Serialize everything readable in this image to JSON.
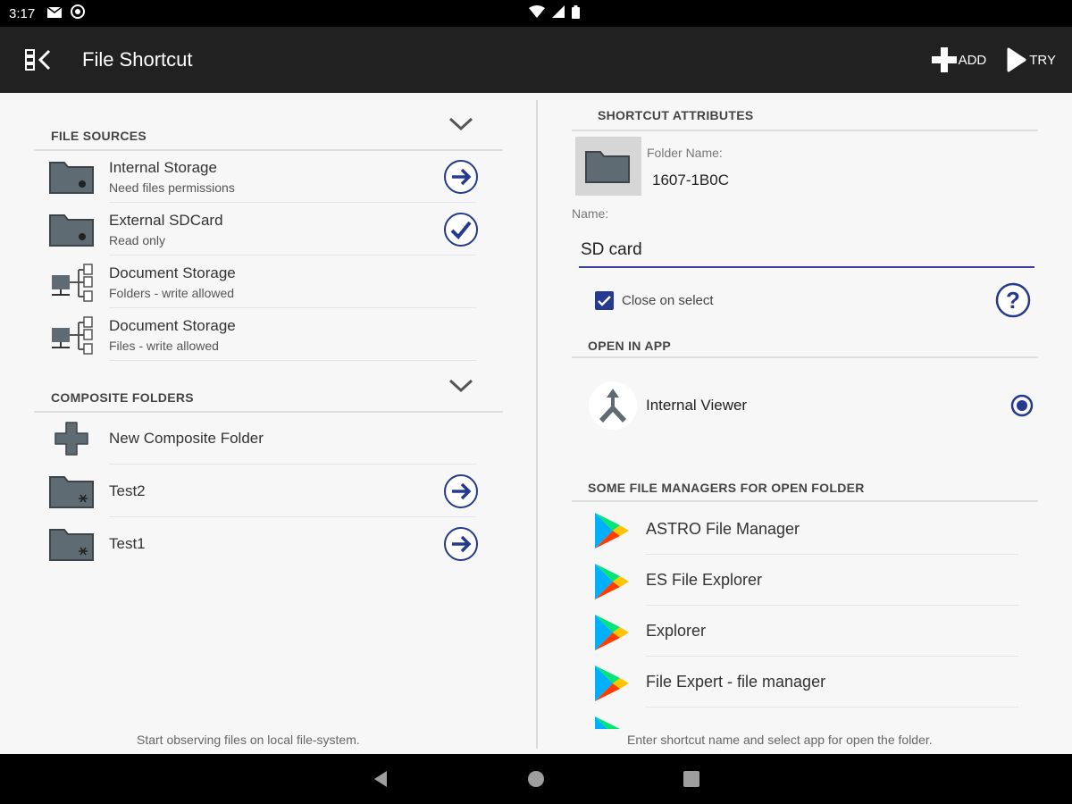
{
  "status": {
    "time": "3:17"
  },
  "toolbar": {
    "title": "File Shortcut",
    "add_label": "ADD",
    "try_label": "TRY"
  },
  "left": {
    "file_sources_heading": "FILE SOURCES",
    "file_sources": [
      {
        "title": "Internal Storage",
        "subtitle": "Need files permissions",
        "icon": "folder-icon",
        "action": "arrow-right-circle-icon"
      },
      {
        "title": "External SDCard",
        "subtitle": "Read only",
        "icon": "folder-icon",
        "action": "check-circle-icon"
      },
      {
        "title": "Document Storage",
        "subtitle": "Folders - write allowed",
        "icon": "document-tree-icon",
        "action": ""
      },
      {
        "title": "Document Storage",
        "subtitle": "Files - write allowed",
        "icon": "document-tree-icon",
        "action": ""
      }
    ],
    "composite_heading": "COMPOSITE FOLDERS",
    "composite": [
      {
        "title": "New Composite Folder",
        "icon": "plus-icon",
        "action": ""
      },
      {
        "title": "Test2",
        "icon": "folder-icon",
        "action": "arrow-right-circle-icon"
      },
      {
        "title": "Test1",
        "icon": "folder-icon",
        "action": "arrow-right-circle-icon"
      }
    ],
    "footer": "Start observing files on local file-system."
  },
  "right": {
    "attributes_heading": "SHORTCUT ATTRIBUTES",
    "folder_name_label": "Folder Name:",
    "folder_name_value": "1607-1B0C",
    "name_label": "Name:",
    "name_value": "SD card",
    "close_on_select_label": "Close on select",
    "open_in_app_heading": "OPEN IN APP",
    "internal_viewer_label": "Internal Viewer",
    "file_managers_heading": "SOME FILE MANAGERS FOR OPEN FOLDER",
    "file_managers": [
      "ASTRO File Manager",
      "ES File Explorer",
      "Explorer",
      "File Expert - file manager"
    ],
    "footer": "Enter shortcut name and select app for open the folder."
  },
  "colors": {
    "accent": "#253a8f",
    "toolbar": "#212121",
    "folder": "#5f6b73"
  }
}
